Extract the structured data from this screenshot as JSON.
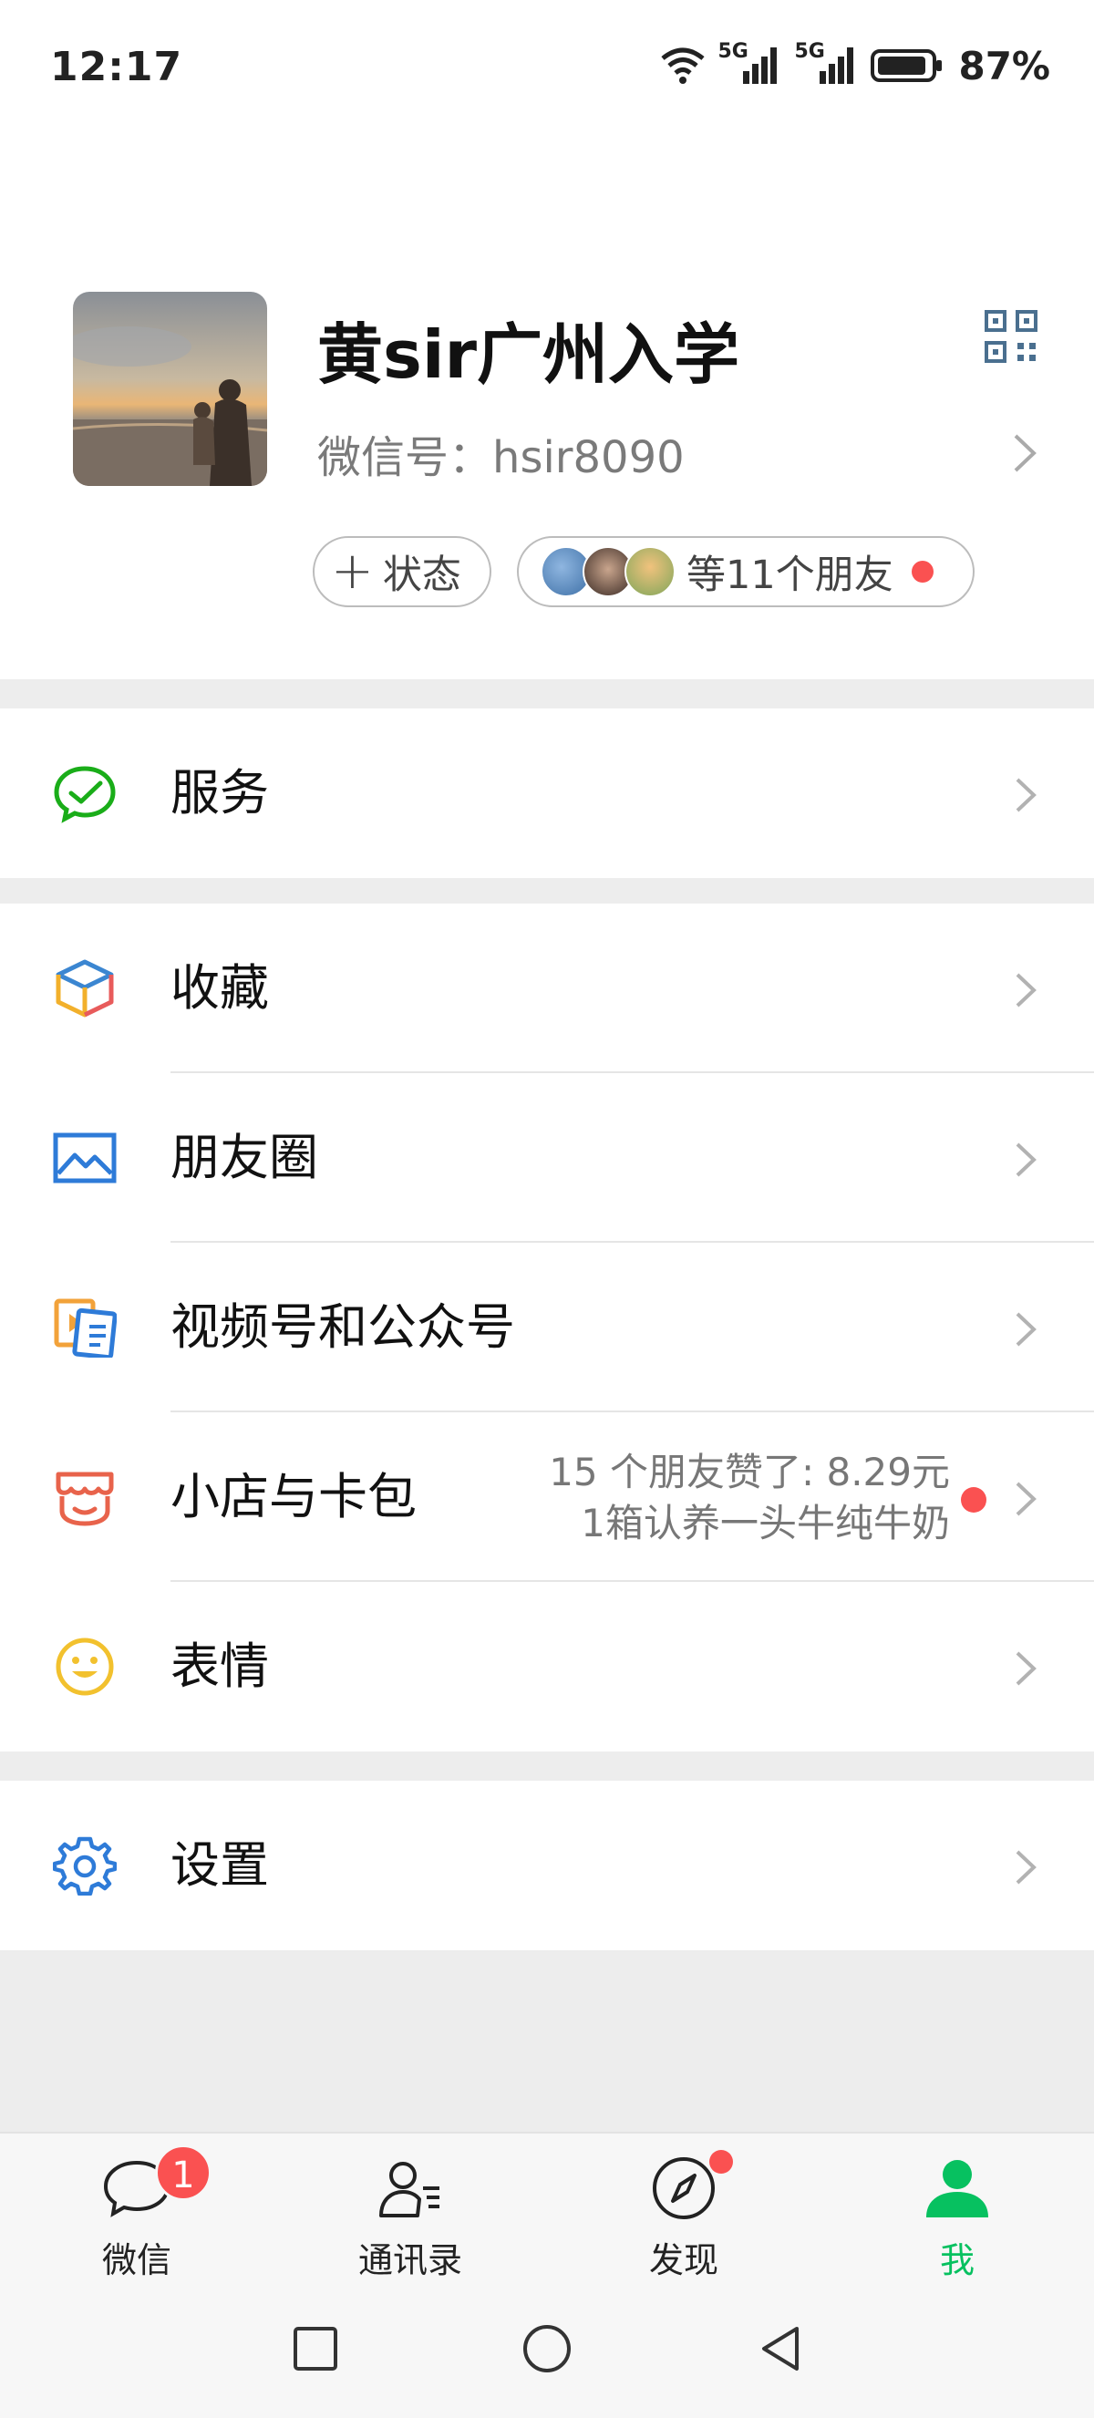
{
  "status_bar": {
    "time": "12:17",
    "battery_pct": "87%",
    "network_1": "5G",
    "network_2": "5G"
  },
  "profile": {
    "name": "黄sir广州入学",
    "wechat_id_label": "微信号：",
    "wechat_id": "hsir8090",
    "status_chip_label": "状态",
    "friends_chip_label": "等11个朋友"
  },
  "menu": {
    "services": "服务",
    "favorites": "收藏",
    "moments": "朋友圈",
    "channels": "视频号和公众号",
    "shop": "小店与卡包",
    "shop_promo_line1": "15 个朋友赞了: 8.29元",
    "shop_promo_line2": "1箱认养一头牛纯牛奶",
    "stickers": "表情",
    "settings": "设置"
  },
  "tab_bar": {
    "chats": "微信",
    "chats_badge": "1",
    "contacts": "通讯录",
    "discover": "发现",
    "me": "我"
  },
  "colors": {
    "accent": "#07c160",
    "badge_red": "#fa5151",
    "icon_blue": "#2e7bd8",
    "background": "#ededed"
  },
  "icons": {
    "services": "wechat-pay-icon",
    "favorites": "cube-icon",
    "moments": "picture-icon",
    "channels": "channels-icon",
    "shop": "shop-icon",
    "stickers": "smile-icon",
    "settings": "gear-icon"
  }
}
